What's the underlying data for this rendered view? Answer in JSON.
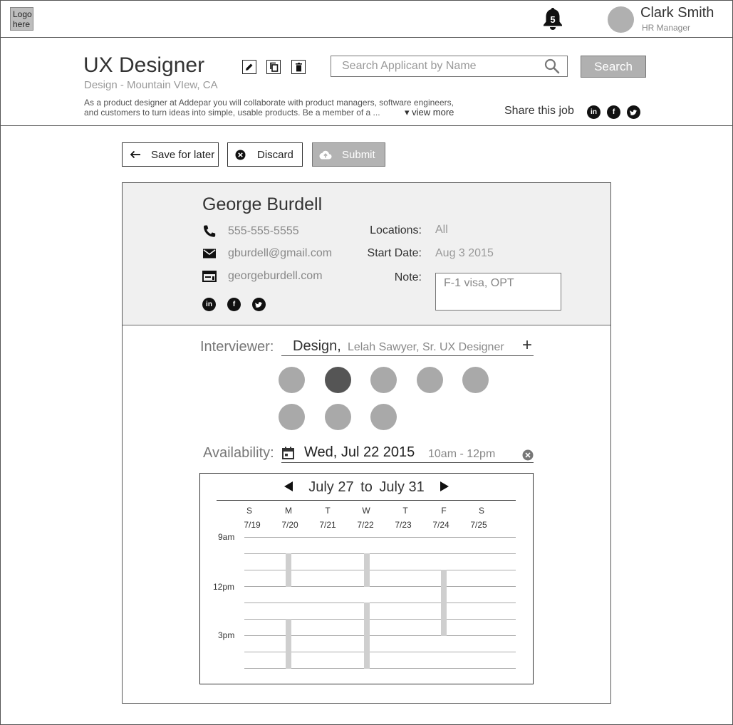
{
  "header": {
    "logo_text": "Logo here",
    "notifications_count": "5",
    "user_name": "Clark Smith",
    "user_role": "HR Manager"
  },
  "job": {
    "title": "UX Designer",
    "subtitle": "Design - Mountain VIew, CA",
    "description_line1": "As a product designer at Addepar you will collaborate with product managers, software engineers,",
    "description_line2": "and customers to turn ideas into simple, usable products. Be a member of a ...",
    "view_more": "▾ view more",
    "share_label": "Share this job",
    "search_placeholder": "Search Applicant by Name",
    "search_button": "Search"
  },
  "actions": {
    "save_label": "Save for later",
    "discard_label": "Discard",
    "submit_label": "Submit"
  },
  "applicant": {
    "name": "George Burdell",
    "phone": "555-555-5555",
    "email": "gburdell@gmail.com",
    "website": "georgeburdell.com",
    "locations_label": "Locations:",
    "locations_value": "All",
    "start_date_label": "Start Date:",
    "start_date_value": "Aug 3  2015",
    "note_label": "Note:",
    "note_value": "F-1 visa, OPT"
  },
  "interviewer": {
    "label": "Interviewer:",
    "department": "Design,",
    "person": "Lelah Sawyer, Sr. UX Designer",
    "add_symbol": "+"
  },
  "availability": {
    "label": "Availability:",
    "date": "Wed, Jul 22  2015",
    "time": "10am - 12pm"
  },
  "calendar": {
    "range_start": "July 27",
    "range_to": "to",
    "range_end": "July 31",
    "days": [
      {
        "letter": "S",
        "date": "7/19"
      },
      {
        "letter": "M",
        "date": "7/20"
      },
      {
        "letter": "T",
        "date": "7/21"
      },
      {
        "letter": "W",
        "date": "7/22"
      },
      {
        "letter": "T",
        "date": "7/23"
      },
      {
        "letter": "F",
        "date": "7/24"
      },
      {
        "letter": "S",
        "date": "7/25"
      }
    ],
    "time_labels": [
      "9am",
      "12pm",
      "3pm"
    ]
  }
}
